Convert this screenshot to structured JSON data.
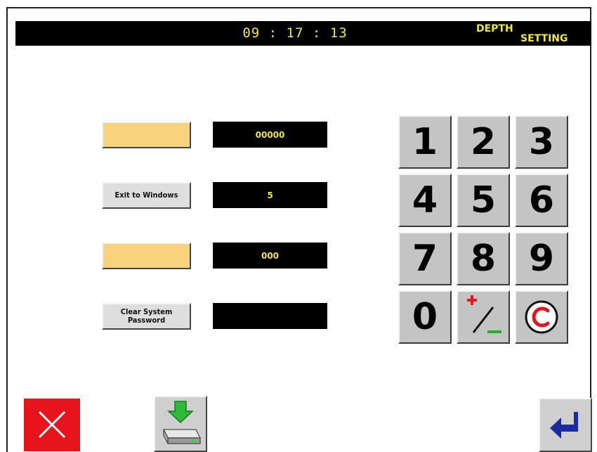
{
  "header": {
    "time": "09 : 17 : 13",
    "mode_line1": "DEPTH",
    "mode_line2": "SETTING"
  },
  "params": [
    {
      "label": "",
      "value": "00000",
      "color": "#f8d27d"
    },
    {
      "label": "Exit to Windows",
      "value": "5",
      "color": "#dedede"
    },
    {
      "label": "",
      "value": "000",
      "color": "#f8d27d"
    },
    {
      "label_line1": "Clear System",
      "label_line2": "Password",
      "value": "",
      "color": "#dedede"
    }
  ],
  "keypad": {
    "keys": [
      "1",
      "2",
      "3",
      "4",
      "5",
      "6",
      "7",
      "8",
      "9",
      "0"
    ],
    "sign_icon": "plus-minus-icon",
    "clear_icon": "clear-c-icon"
  },
  "bottom": {
    "cancel_icon": "close-icon",
    "save_icon": "save-to-drive-icon",
    "enter_icon": "enter-return-icon"
  },
  "colors": {
    "accent_text": "#f2e92a",
    "cancel_red": "#e8141b",
    "enter_blue": "#1b2a9e",
    "sign_green": "#1db324"
  }
}
